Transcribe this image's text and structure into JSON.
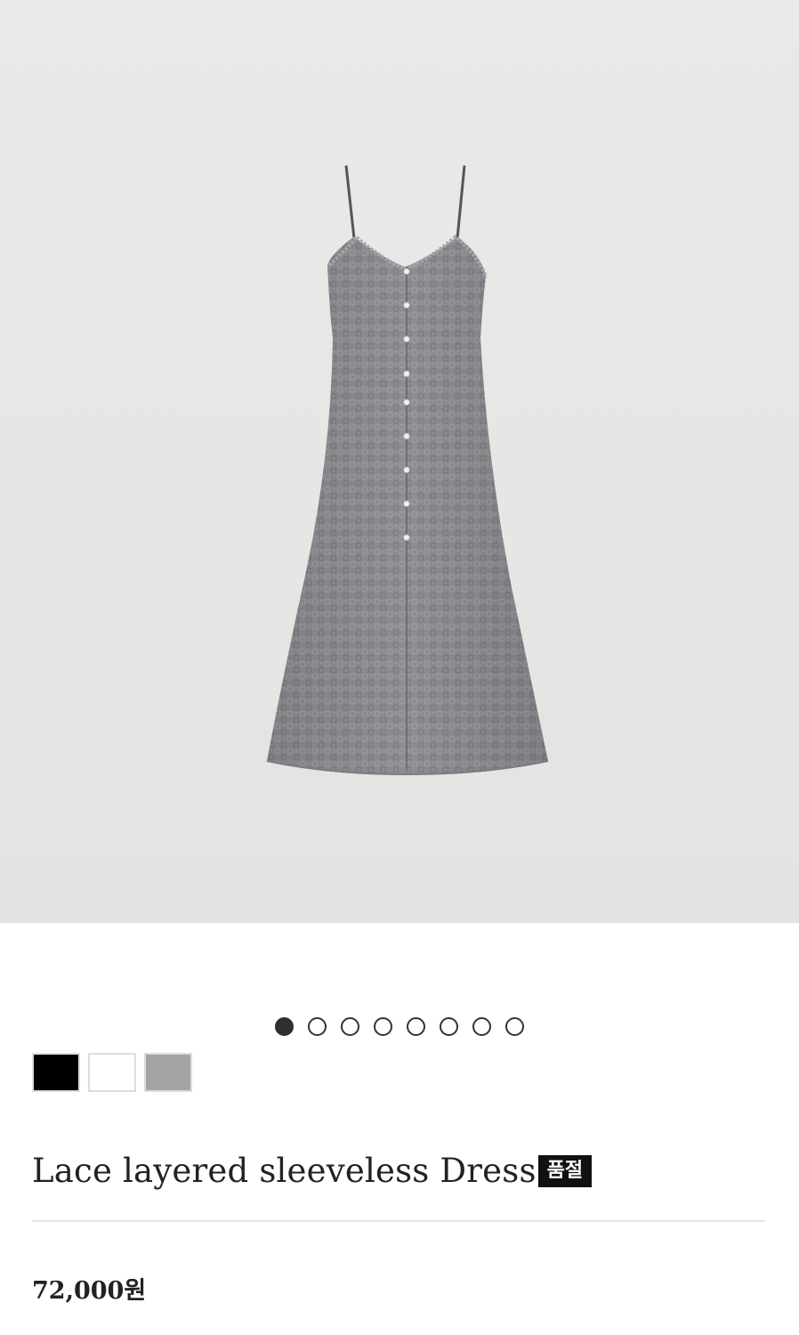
{
  "product": {
    "title": "Lace layered sleeveless Dress",
    "sold_out_badge": "품절",
    "price": "72,000원"
  },
  "gallery": {
    "image_count": 8,
    "active_index": 0
  },
  "colors": [
    {
      "name": "black",
      "hex": "#000000"
    },
    {
      "name": "white",
      "hex": "#ffffff"
    },
    {
      "name": "gray",
      "hex": "#a4a4a4"
    }
  ],
  "palette": {
    "dress": "#8d8c90",
    "dress_shadow": "#7b7a7f",
    "background": "#e7e7e5"
  }
}
